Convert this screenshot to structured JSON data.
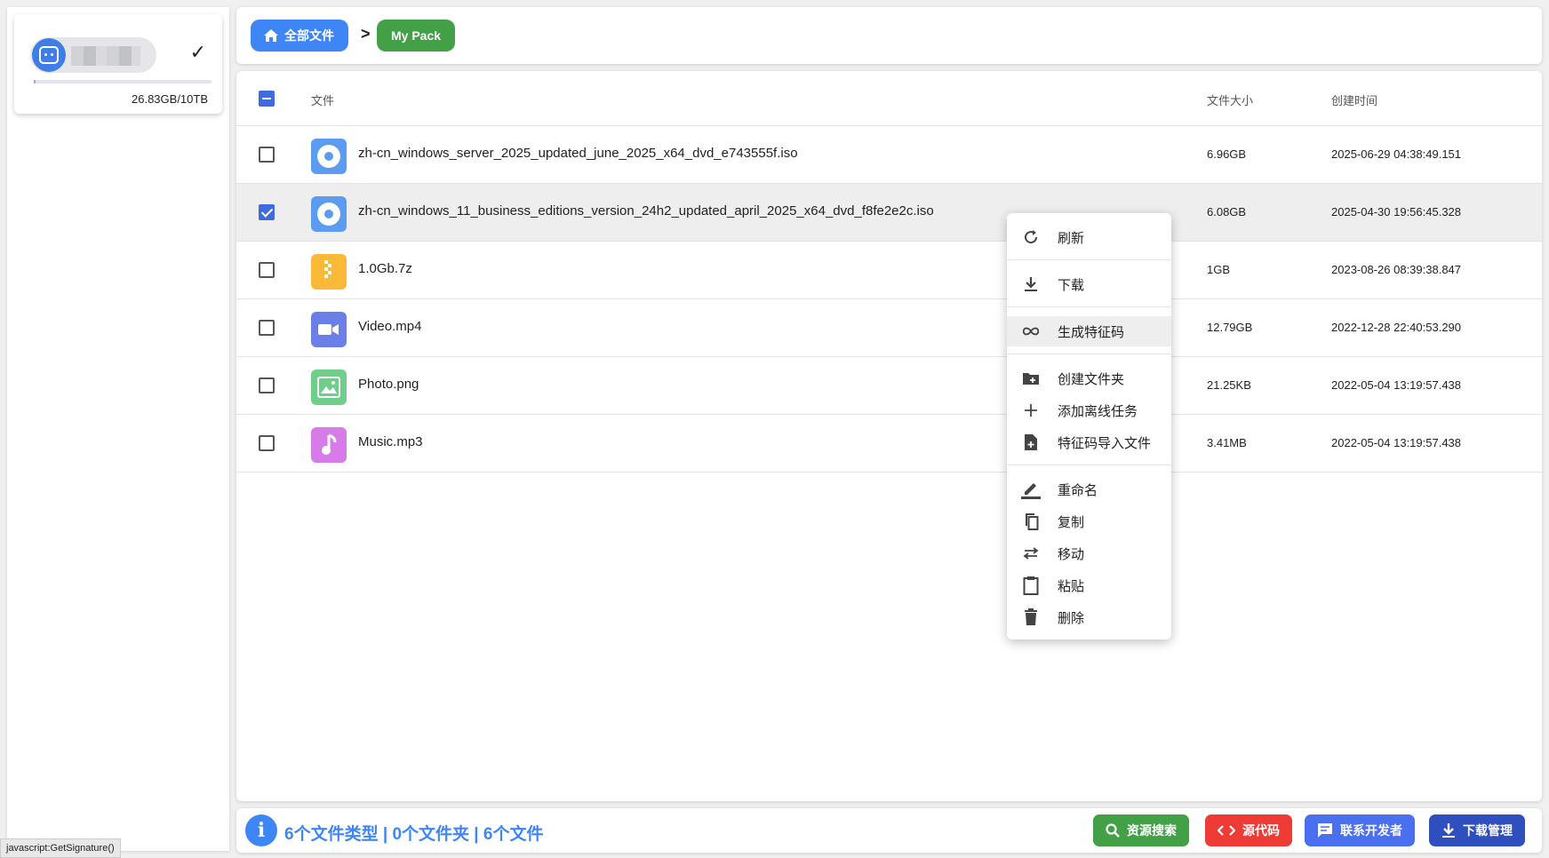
{
  "sidebar": {
    "quota_text": "26.83GB/10TB",
    "quota_used_fraction": 0.0026
  },
  "breadcrumb": {
    "home_label": "全部文件",
    "separator": ">",
    "current_label": "My Pack"
  },
  "table": {
    "headers": {
      "name": "文件",
      "size": "文件大小",
      "time": "创建时间"
    },
    "rows": [
      {
        "name": "zh-cn_windows_server_2025_updated_june_2025_x64_dvd_e743555f.iso",
        "size": "6.96GB",
        "time": "2025-06-29 04:38:49.151",
        "icon": "disc-icon",
        "color": "#5b9cf0",
        "checked": false
      },
      {
        "name": "zh-cn_windows_11_business_editions_version_24h2_updated_april_2025_x64_dvd_f8fe2e2c.iso",
        "size": "6.08GB",
        "time": "2025-04-30 19:56:45.328",
        "icon": "disc-icon",
        "color": "#5b9cf0",
        "checked": true
      },
      {
        "name": "1.0Gb.7z",
        "size": "1GB",
        "time": "2023-08-26 08:39:38.847",
        "icon": "archive-icon",
        "color": "#fbb938",
        "checked": false
      },
      {
        "name": "Video.mp4",
        "size": "12.79GB",
        "time": "2022-12-28 22:40:53.290",
        "icon": "video-icon",
        "color": "#6a7fe8",
        "checked": false
      },
      {
        "name": "Photo.png",
        "size": "21.25KB",
        "time": "2022-05-04 13:19:57.438",
        "icon": "image-icon",
        "color": "#6fcf8a",
        "checked": false
      },
      {
        "name": "Music.mp3",
        "size": "3.41MB",
        "time": "2022-05-04 13:19:57.438",
        "icon": "music-icon",
        "color": "#d77be8",
        "checked": false
      }
    ]
  },
  "context_menu": {
    "items": [
      {
        "label": "刷新",
        "icon": "refresh-icon"
      },
      {
        "label": "下载",
        "icon": "download-icon"
      },
      {
        "label": "生成特征码",
        "icon": "link-icon"
      },
      {
        "label": "创建文件夹",
        "icon": "folder-add-icon"
      },
      {
        "label": "添加离线任务",
        "icon": "plus-icon"
      },
      {
        "label": "特征码导入文件",
        "icon": "file-import-icon"
      },
      {
        "label": "重命名",
        "icon": "edit-icon"
      },
      {
        "label": "复制",
        "icon": "copy-icon"
      },
      {
        "label": "移动",
        "icon": "move-icon"
      },
      {
        "label": "粘贴",
        "icon": "paste-icon"
      },
      {
        "label": "删除",
        "icon": "delete-icon"
      }
    ]
  },
  "footer": {
    "info_glyph": "i",
    "stats": "6个文件类型 | 0个文件夹 | 6个文件",
    "buttons": {
      "search": "资源搜索",
      "source": "源代码",
      "contact": "联系开发者",
      "downloads": "下载管理"
    },
    "colors": {
      "search": "#43a047",
      "source": "#ef3b36",
      "contact": "#4a6ff0",
      "downloads": "#2f4fbf"
    }
  },
  "status_bar": "javascript:GetSignature()"
}
